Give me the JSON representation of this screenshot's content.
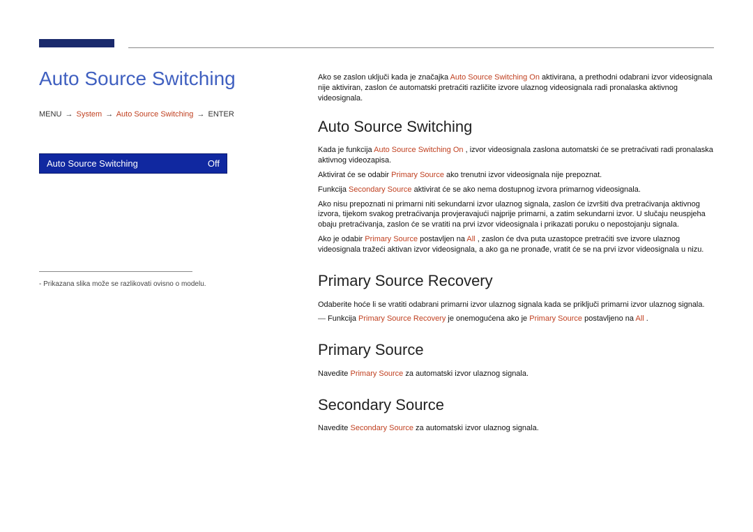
{
  "left": {
    "title": "Auto Source Switching",
    "breadcrumb": {
      "b1": "MENU",
      "b2": "System",
      "b3": "Auto Source Switching",
      "b4": "ENTER"
    },
    "menu": {
      "label": "Auto Source Switching",
      "value": "Off"
    },
    "note": "-  Prikazana slika može se razlikovati ovisno o modelu."
  },
  "right": {
    "intro1a": "Ako se zaslon uključi kada je značajka ",
    "intro1_em": "Auto Source Switching On",
    "intro1b": " aktivirana, a prethodni odabrani izvor videosignala nije aktiviran, zaslon će automatski pretraćiti različite izvore ulaznog videosignala radi pronalaska aktivnog videosignala.",
    "sec1_h": "Auto Source Switching",
    "p1a": "Kada je funkcija ",
    "p1_em": "Auto Source Switching On",
    "p1b": ", izvor videosignala zaslona automatski će se pretraćivati radi pronalaska aktivnog videozapisa.",
    "p2a": "Aktivirat će se odabir ",
    "p2_em": "Primary Source",
    "p2b": " ako trenutni izvor videosignala nije prepoznat.",
    "p3a": "Funkcija ",
    "p3_em": "Secondary Source",
    "p3b": " aktivirat će se ako nema dostupnog izvora primarnog videosignala.",
    "p4": "Ako nisu prepoznati ni primarni niti sekundarni izvor ulaznog signala, zaslon će izvršiti dva pretraćivanja aktivnog izvora, tijekom svakog pretraćivanja provjeravajući najprije primarni, a zatim sekundarni izvor. U slučaju neuspjeha obaju pretraćivanja, zaslon će se vratiti na prvi izvor videosignala i prikazati poruku o nepostojanju signala.",
    "p5a": "Ako je odabir ",
    "p5_em1": "Primary Source",
    "p5b": " postavljen na ",
    "p5_em2": "All",
    "p5c": ", zaslon će dva puta uzastopce pretraćiti sve izvore ulaznog videosignala tražeći aktivan izvor videosignala, a ako ga ne pronađe, vratit će se na prvi izvor videosignala u nizu.",
    "sec2_h": "Primary Source Recovery",
    "p6": "Odaberite hoće li se vratiti odabrani primarni izvor ulaznog signala kada se priključi primarni izvor ulaznog signala.",
    "note2a": "Funkcija ",
    "note2_em1": "Primary Source Recovery",
    "note2b": " je onemogućena ako je ",
    "note2_em2": "Primary Source",
    "note2c": " postavljeno na ",
    "note2_em3": "All",
    "note2d": ".",
    "sec3_h": "Primary Source",
    "p7a": "Navedite ",
    "p7_em": "Primary Source",
    "p7b": " za automatski izvor ulaznog signala.",
    "sec4_h": "Secondary Source",
    "p8a": "Navedite ",
    "p8_em": "Secondary Source",
    "p8b": " za automatski izvor ulaznog signala."
  }
}
